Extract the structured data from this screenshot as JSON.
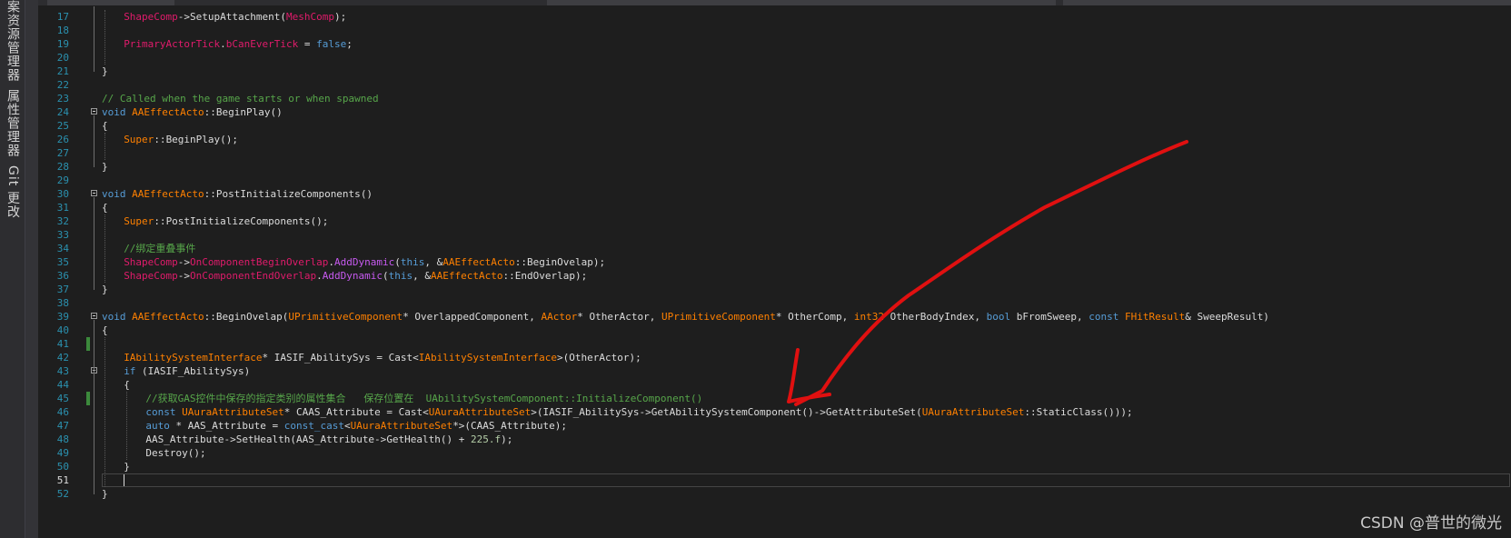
{
  "tool_strip": {
    "tabs": [
      {
        "label": "案资源管理器"
      },
      {
        "label": "属性管理器"
      },
      {
        "label": "Git 更改"
      }
    ]
  },
  "editor": {
    "current_line": 51,
    "lines": [
      {
        "n": 17,
        "depth": 1,
        "tokens": [
          {
            "t": "ShapeComp",
            "c": "mem"
          },
          {
            "t": "->"
          },
          {
            "t": "SetupAttachment"
          },
          {
            "t": "("
          },
          {
            "t": "MeshComp",
            "c": "mem"
          },
          {
            "t": ");"
          }
        ]
      },
      {
        "n": 18,
        "depth": 1,
        "tokens": []
      },
      {
        "n": 19,
        "depth": 1,
        "tokens": [
          {
            "t": "PrimaryActorTick",
            "c": "mem"
          },
          {
            "t": "."
          },
          {
            "t": "bCanEverTick",
            "c": "mem"
          },
          {
            "t": " = "
          },
          {
            "t": "false",
            "c": "kw"
          },
          {
            "t": ";"
          }
        ]
      },
      {
        "n": 20,
        "depth": 1,
        "tokens": []
      },
      {
        "n": 21,
        "depth": 0,
        "tokens": [
          {
            "t": "}"
          }
        ]
      },
      {
        "n": 22,
        "depth": 0,
        "tokens": []
      },
      {
        "n": 23,
        "depth": 0,
        "tokens": [
          {
            "t": "// Called when the game starts or when spawned",
            "c": "cm"
          }
        ]
      },
      {
        "n": 24,
        "depth": 0,
        "fold": true,
        "tokens": [
          {
            "t": "void",
            "c": "kw"
          },
          {
            "t": " "
          },
          {
            "t": "AAEffectActo",
            "c": "ty"
          },
          {
            "t": "::"
          },
          {
            "t": "BeginPlay"
          },
          {
            "t": "()"
          }
        ]
      },
      {
        "n": 25,
        "depth": 0,
        "tokens": [
          {
            "t": "{"
          }
        ]
      },
      {
        "n": 26,
        "depth": 1,
        "tokens": [
          {
            "t": "Super",
            "c": "ty"
          },
          {
            "t": "::"
          },
          {
            "t": "BeginPlay"
          },
          {
            "t": "();"
          }
        ]
      },
      {
        "n": 27,
        "depth": 1,
        "tokens": []
      },
      {
        "n": 28,
        "depth": 0,
        "tokens": [
          {
            "t": "}"
          }
        ]
      },
      {
        "n": 29,
        "depth": 0,
        "tokens": []
      },
      {
        "n": 30,
        "depth": 0,
        "fold": true,
        "tokens": [
          {
            "t": "void",
            "c": "kw"
          },
          {
            "t": " "
          },
          {
            "t": "AAEffectActo",
            "c": "ty"
          },
          {
            "t": "::"
          },
          {
            "t": "PostInitializeComponents"
          },
          {
            "t": "()"
          }
        ]
      },
      {
        "n": 31,
        "depth": 0,
        "tokens": [
          {
            "t": "{"
          }
        ]
      },
      {
        "n": 32,
        "depth": 1,
        "tokens": [
          {
            "t": "Super",
            "c": "ty"
          },
          {
            "t": "::"
          },
          {
            "t": "PostInitializeComponents"
          },
          {
            "t": "();"
          }
        ]
      },
      {
        "n": 33,
        "depth": 1,
        "tokens": []
      },
      {
        "n": 34,
        "depth": 1,
        "tokens": [
          {
            "t": "//绑定重叠事件",
            "c": "cm"
          }
        ]
      },
      {
        "n": 35,
        "depth": 1,
        "tokens": [
          {
            "t": "ShapeComp",
            "c": "mem"
          },
          {
            "t": "->"
          },
          {
            "t": "OnComponentBeginOverlap",
            "c": "mem"
          },
          {
            "t": "."
          },
          {
            "t": "AddDynamic",
            "c": "mac"
          },
          {
            "t": "("
          },
          {
            "t": "this",
            "c": "kw"
          },
          {
            "t": ", &"
          },
          {
            "t": "AAEffectActo",
            "c": "ty"
          },
          {
            "t": "::"
          },
          {
            "t": "BeginOvelap"
          },
          {
            "t": ");"
          }
        ]
      },
      {
        "n": 36,
        "depth": 1,
        "tokens": [
          {
            "t": "ShapeComp",
            "c": "mem"
          },
          {
            "t": "->"
          },
          {
            "t": "OnComponentEndOverlap",
            "c": "mem"
          },
          {
            "t": "."
          },
          {
            "t": "AddDynamic",
            "c": "mac"
          },
          {
            "t": "("
          },
          {
            "t": "this",
            "c": "kw"
          },
          {
            "t": ", &"
          },
          {
            "t": "AAEffectActo",
            "c": "ty"
          },
          {
            "t": "::"
          },
          {
            "t": "EndOverlap"
          },
          {
            "t": ");"
          }
        ]
      },
      {
        "n": 37,
        "depth": 0,
        "tokens": [
          {
            "t": "}"
          }
        ]
      },
      {
        "n": 38,
        "depth": 0,
        "tokens": []
      },
      {
        "n": 39,
        "depth": 0,
        "fold": true,
        "tokens": [
          {
            "t": "void",
            "c": "kw"
          },
          {
            "t": " "
          },
          {
            "t": "AAEffectActo",
            "c": "ty"
          },
          {
            "t": "::"
          },
          {
            "t": "BeginOvelap"
          },
          {
            "t": "("
          },
          {
            "t": "UPrimitiveComponent",
            "c": "ty"
          },
          {
            "t": "* OverlappedComponent, "
          },
          {
            "t": "AActor",
            "c": "ty"
          },
          {
            "t": "* OtherActor, "
          },
          {
            "t": "UPrimitiveComponent",
            "c": "ty"
          },
          {
            "t": "* OtherComp, "
          },
          {
            "t": "int32",
            "c": "ty"
          },
          {
            "t": " OtherBodyIndex, "
          },
          {
            "t": "bool",
            "c": "kw"
          },
          {
            "t": " bFromSweep, "
          },
          {
            "t": "const",
            "c": "kw"
          },
          {
            "t": " "
          },
          {
            "t": "FHitResult",
            "c": "ty"
          },
          {
            "t": "& SweepResult)"
          }
        ]
      },
      {
        "n": 40,
        "depth": 0,
        "tokens": [
          {
            "t": "{"
          }
        ]
      },
      {
        "n": 41,
        "depth": 1,
        "changed": true,
        "tokens": []
      },
      {
        "n": 42,
        "depth": 1,
        "tokens": [
          {
            "t": "IAbilitySystemInterface",
            "c": "ty"
          },
          {
            "t": "* IASIF_AbilitySys = "
          },
          {
            "t": "Cast"
          },
          {
            "t": "<"
          },
          {
            "t": "IAbilitySystemInterface",
            "c": "ty"
          },
          {
            "t": ">(OtherActor);"
          }
        ]
      },
      {
        "n": 43,
        "depth": 1,
        "fold": true,
        "tokens": [
          {
            "t": "if",
            "c": "kw"
          },
          {
            "t": " (IASIF_AbilitySys)"
          }
        ]
      },
      {
        "n": 44,
        "depth": 1,
        "tokens": [
          {
            "t": "{"
          }
        ]
      },
      {
        "n": 45,
        "depth": 2,
        "changed": true,
        "tokens": [
          {
            "t": "//获取GAS控件中保存的指定类别的属性集合   保存位置在  UAbilitySystemComponent::InitializeComponent()",
            "c": "cm"
          }
        ]
      },
      {
        "n": 46,
        "depth": 2,
        "tokens": [
          {
            "t": "const",
            "c": "kw"
          },
          {
            "t": " "
          },
          {
            "t": "UAuraAttributeSet",
            "c": "ty"
          },
          {
            "t": "* CAAS_Attribute = "
          },
          {
            "t": "Cast"
          },
          {
            "t": "<"
          },
          {
            "t": "UAuraAttributeSet",
            "c": "ty"
          },
          {
            "t": ">(IASIF_AbilitySys->"
          },
          {
            "t": "GetAbilitySystemComponent"
          },
          {
            "t": "()->"
          },
          {
            "t": "GetAttributeSet"
          },
          {
            "t": "("
          },
          {
            "t": "UAuraAttributeSet",
            "c": "ty"
          },
          {
            "t": "::"
          },
          {
            "t": "StaticClass"
          },
          {
            "t": "()));"
          }
        ]
      },
      {
        "n": 47,
        "depth": 2,
        "tokens": [
          {
            "t": "auto",
            "c": "kw"
          },
          {
            "t": " * AAS_Attribute = "
          },
          {
            "t": "const_cast",
            "c": "kw"
          },
          {
            "t": "<"
          },
          {
            "t": "UAuraAttributeSet",
            "c": "ty"
          },
          {
            "t": "*>(CAAS_Attribute);"
          }
        ]
      },
      {
        "n": 48,
        "depth": 2,
        "tokens": [
          {
            "t": "AAS_Attribute->"
          },
          {
            "t": "SetHealth"
          },
          {
            "t": "(AAS_Attribute->"
          },
          {
            "t": "GetHealth"
          },
          {
            "t": "() + "
          },
          {
            "t": "225.f",
            "c": "num"
          },
          {
            "t": ");"
          }
        ]
      },
      {
        "n": 49,
        "depth": 2,
        "tokens": [
          {
            "t": "Destroy"
          },
          {
            "t": "();"
          }
        ]
      },
      {
        "n": 50,
        "depth": 1,
        "tokens": [
          {
            "t": "}"
          }
        ]
      },
      {
        "n": 51,
        "depth": 1,
        "tokens": []
      },
      {
        "n": 52,
        "depth": 0,
        "tokens": [
          {
            "t": "}"
          }
        ]
      }
    ]
  },
  "watermark": {
    "text": "CSDN @普世的微光"
  },
  "annotation": {
    "color": "#e01010"
  }
}
